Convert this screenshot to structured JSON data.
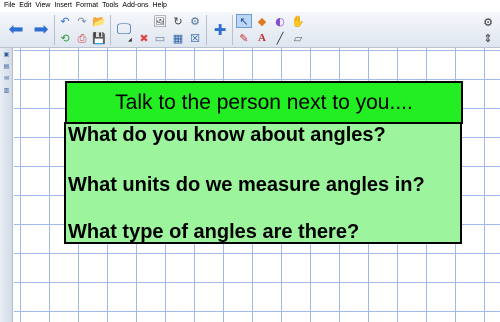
{
  "menu": [
    "File",
    "Edit",
    "View",
    "Insert",
    "Format",
    "Tools",
    "Add-ons",
    "Help"
  ],
  "toolbar": {
    "icons": [
      "back-arrow-icon",
      "forward-arrow-icon",
      "undo-icon",
      "redo-icon",
      "open-folder-icon",
      "page-icon",
      "save-icon",
      "print-icon",
      "screen-display-icon",
      "delete-icon",
      "screen-shade-icon",
      "image-icon",
      "table-icon",
      "rotate-icon",
      "fill-icon",
      "eraser-icon",
      "add-page-icon",
      "select-arrow-icon",
      "paint-bucket-icon",
      "highlighter-icon",
      "hand-icon",
      "pens-icon",
      "text-icon",
      "line-icon",
      "shape-eraser-icon",
      "settings-gear-icon",
      "expand-icon"
    ]
  },
  "slide": {
    "title": "Talk to the person next to you....",
    "questions": [
      "What do you know about angles?",
      "What units do we measure angles in?",
      "What type of angles are there?"
    ],
    "title_color": "#22ee22",
    "box_color": "#9cf59c"
  }
}
